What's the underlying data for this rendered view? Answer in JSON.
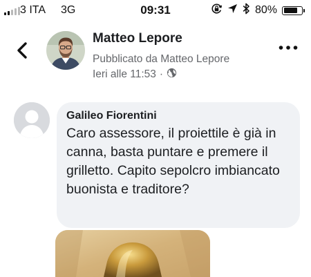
{
  "status_bar": {
    "carrier": "3 ITA",
    "network": "3G",
    "time": "09:31",
    "battery_percent": "80%",
    "battery_level": 0.8,
    "signal_bars_filled": 2,
    "icons": [
      "signal-icon",
      "rotation-lock-icon",
      "location-arrow-icon",
      "bluetooth-icon",
      "battery-icon"
    ]
  },
  "post": {
    "author": "Matteo Lepore",
    "published_by": "Pubblicato da Matteo Lepore",
    "timestamp": "Ieri alle 11:53",
    "separator": "·",
    "audience_icon": "globe-icon"
  },
  "navigation": {
    "back_icon": "chevron-left-icon",
    "more_icon": "more-options-icon"
  },
  "comment": {
    "author": "Galileo Fiorentini",
    "text": "Caro assessore, il proiettile è già in canna, basta puntare e premere il grilletto. Capito sepolcro imbiancato buonista e traditore?"
  },
  "colors": {
    "bubble_background": "#f0f2f5",
    "secondary_text": "#65676b",
    "primary_text": "#1c1e21"
  }
}
